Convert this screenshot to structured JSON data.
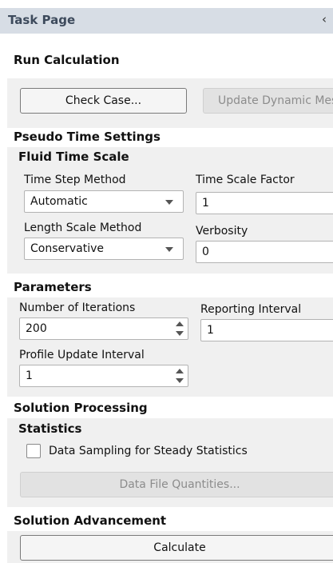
{
  "panel": {
    "title": "Task Page",
    "collapse_glyph": "‹"
  },
  "run": {
    "heading": "Run Calculation",
    "check_case_label": "Check Case...",
    "update_dynamic_mesh_label": "Update Dynamic Mes"
  },
  "pseudo": {
    "heading": "Pseudo Time Settings",
    "subheading": "Fluid Time Scale",
    "time_step_method_label": "Time Step Method",
    "time_step_method_value": "Automatic",
    "time_scale_factor_label": "Time Scale Factor",
    "time_scale_factor_value": "1",
    "length_scale_method_label": "Length Scale Method",
    "length_scale_method_value": "Conservative",
    "verbosity_label": "Verbosity",
    "verbosity_value": "0"
  },
  "parameters": {
    "heading": "Parameters",
    "iterations_label": "Number of Iterations",
    "iterations_value": "200",
    "reporting_label": "Reporting Interval",
    "reporting_value": "1",
    "profile_label": "Profile Update Interval",
    "profile_value": "1"
  },
  "processing": {
    "heading": "Solution Processing",
    "statistics_heading": "Statistics",
    "data_sampling_label": "Data Sampling for Steady Statistics",
    "data_sampling_checked": false,
    "data_file_quantities_label": "Data File Quantities..."
  },
  "advancement": {
    "heading": "Solution Advancement",
    "calculate_label": "Calculate"
  }
}
